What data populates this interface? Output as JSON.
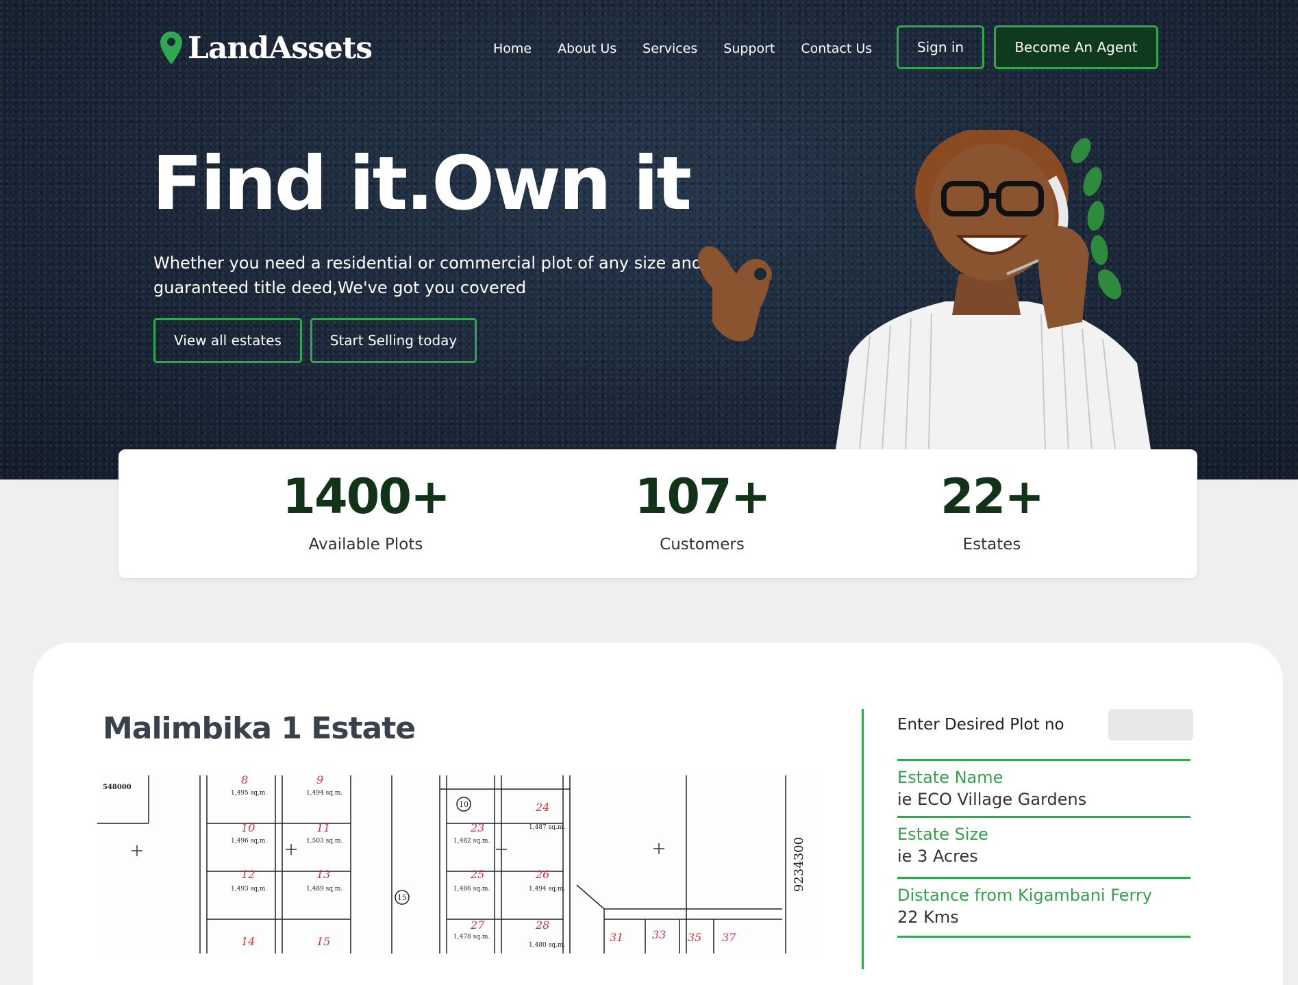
{
  "header": {
    "logo_text": "LandAssets",
    "nav": [
      "Home",
      "About Us",
      "Services",
      "Support",
      "Contact Us"
    ],
    "signin_label": "Sign in",
    "agent_label": "Become An Agent"
  },
  "hero": {
    "title": "Find it.Own it",
    "subtitle_line1": "Whether you need a residential or commercial plot of any size and",
    "subtitle_line2": "guaranteed title deed,We've got you covered",
    "btn_estates": "View all estates",
    "btn_sell": "Start Selling today"
  },
  "stats": [
    {
      "value": "1400+",
      "label": "Available Plots"
    },
    {
      "value": "107+",
      "label": "Customers"
    },
    {
      "value": "22+",
      "label": "Estates"
    }
  ],
  "estate": {
    "title": "Malimbika 1 Estate",
    "plot_label": "Enter Desired Plot no",
    "plot_value": "",
    "fields": [
      {
        "label": "Estate Name",
        "value": "ie ECO Village Gardens"
      },
      {
        "label": "Estate Size",
        "value": "ie 3 Acres"
      },
      {
        "label": "Distance from Kigambani Ferry",
        "value": "22 Kms"
      }
    ],
    "plan": {
      "plots": [
        "8",
        "9",
        "10",
        "11",
        "12",
        "13",
        "14",
        "15",
        "23",
        "24",
        "25",
        "26",
        "27",
        "28",
        "31",
        "33",
        "35",
        "37"
      ],
      "circled": [
        "10",
        "15"
      ],
      "side_coordinate": "9234300",
      "top_left_coordinate": "548000",
      "small_texts": [
        "1,495 sq.m.",
        "1,494 sq.m.",
        "1,496 sq.m.",
        "1,503 sq.m.",
        "1,493 sq.m.",
        "1,489 sq.m.",
        "1,482 sq.m.",
        "1,487 sq.m.",
        "1,486 sq.m.",
        "1,494 sq.m.",
        "1,478 sq.m.",
        "1,480 sq.m."
      ]
    }
  },
  "colors": {
    "accent": "#2fa84f",
    "dark_green": "#123219",
    "hero_bg": "#1c2939"
  }
}
